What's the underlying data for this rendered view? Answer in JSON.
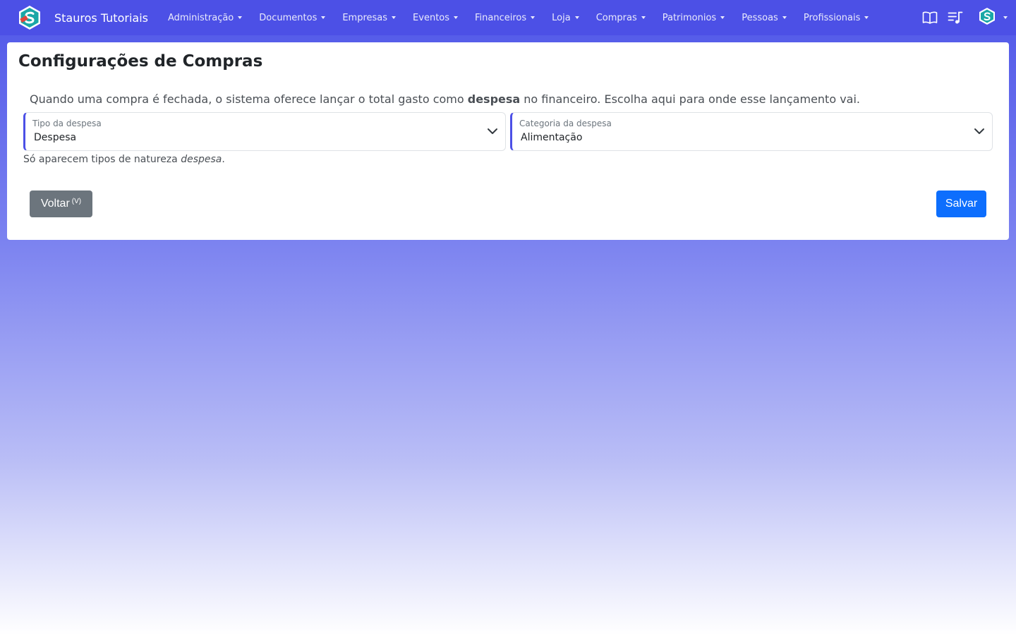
{
  "navbar": {
    "brand": "Stauros Tutoriais",
    "menu": [
      {
        "label": "Administração"
      },
      {
        "label": "Documentos"
      },
      {
        "label": "Empresas"
      },
      {
        "label": "Eventos"
      },
      {
        "label": "Financeiros"
      },
      {
        "label": "Loja"
      },
      {
        "label": "Compras"
      },
      {
        "label": "Patrimonios"
      },
      {
        "label": "Pessoas"
      },
      {
        "label": "Profissionais"
      }
    ],
    "icons": [
      "book-icon",
      "playlist-icon",
      "user-avatar-icon"
    ]
  },
  "page": {
    "title": "Configurações de Compras",
    "description_before": "Quando uma compra é fechada, o sistema oferece lançar o total gasto como ",
    "description_bold": "despesa",
    "description_after": " no financeiro. Escolha aqui para onde esse lançamento vai.",
    "tipo": {
      "label": "Tipo da despesa",
      "value": "Despesa"
    },
    "categoria": {
      "label": "Categoria da despesa",
      "value": "Alimentação"
    },
    "help_before": "Só aparecem tipos de natureza ",
    "help_italic": "despesa",
    "help_after": ".",
    "back_label": "Voltar",
    "back_shortcut": "(V)",
    "save_label": "Salvar"
  },
  "colors": {
    "navbar": "#4c50e6",
    "primary": "#0d6efd",
    "secondary": "#6c757d"
  }
}
